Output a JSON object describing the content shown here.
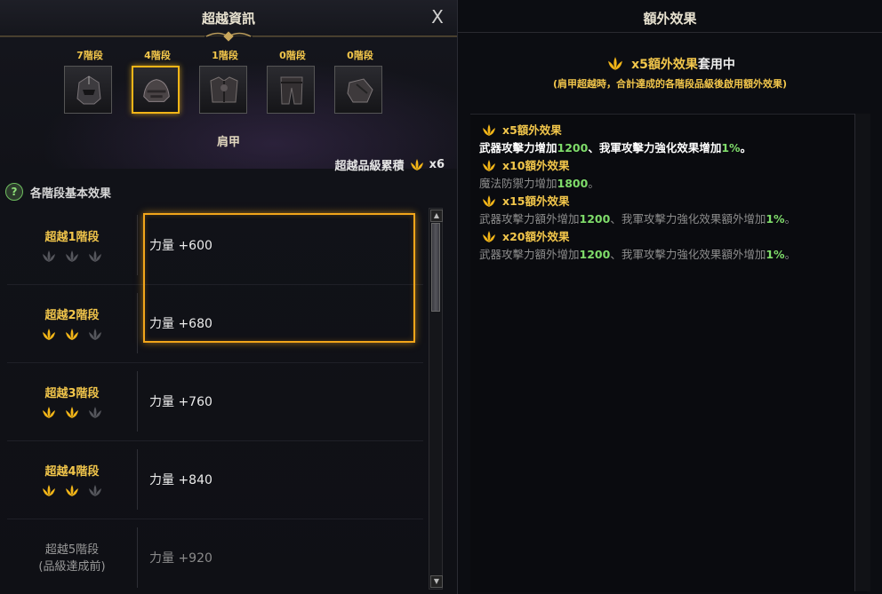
{
  "left_panel": {
    "title": "超越資訊",
    "close_label": "X",
    "gear": [
      {
        "stage": "7階段",
        "icon": "helmet-icon"
      },
      {
        "stage": "4階段",
        "icon": "shoulder-armor-icon"
      },
      {
        "stage": "1階段",
        "icon": "chest-armor-icon"
      },
      {
        "stage": "0階段",
        "icon": "pants-armor-icon"
      },
      {
        "stage": "0階段",
        "icon": "gloves-icon"
      }
    ],
    "selected_part": "肩甲",
    "cumulative_label": "超越品級累積",
    "cumulative_count": "x6",
    "basic_effects_title": "各階段基本效果",
    "rows": [
      {
        "stage": "超越1階段",
        "sub": "",
        "value": "力量 +600",
        "flowers_lit": 0,
        "locked": false
      },
      {
        "stage": "超越2階段",
        "sub": "",
        "value": "力量 +680",
        "flowers_lit": 2,
        "locked": false
      },
      {
        "stage": "超越3階段",
        "sub": "",
        "value": "力量 +760",
        "flowers_lit": 2,
        "locked": false
      },
      {
        "stage": "超越4階段",
        "sub": "",
        "value": "力量 +840",
        "flowers_lit": 2,
        "locked": false
      },
      {
        "stage": "超越5階段",
        "sub": "(品級達成前)",
        "value": "力量 +920",
        "flowers_lit": 0,
        "locked": true
      }
    ]
  },
  "right_panel": {
    "title": "額外效果",
    "active_gold": "x5額外效果",
    "active_white": "套用中",
    "note": "(肩甲超越時，合計達成的各階段品級後啟用額外效果)",
    "effects": [
      {
        "head": "x5額外效果",
        "pre": "武器攻擊力增加",
        "n1": "1200",
        "mid": "、我軍攻擊力強化效果增加",
        "n2": "1%",
        "post": "。",
        "active": true
      },
      {
        "head": "x10額外效果",
        "pre": "魔法防禦力增加",
        "n1": "1800",
        "mid": "",
        "n2": "",
        "post": "。",
        "active": false
      },
      {
        "head": "x15額外效果",
        "pre": "武器攻擊力額外增加",
        "n1": "1200",
        "mid": "、我軍攻擊力強化效果額外增加",
        "n2": "1%",
        "post": "。",
        "active": false
      },
      {
        "head": "x20額外效果",
        "pre": "武器攻擊力額外增加",
        "n1": "1200",
        "mid": "、我軍攻擊力強化效果額外增加",
        "n2": "1%",
        "post": "。",
        "active": false
      }
    ]
  },
  "colors": {
    "accent_gold": "#f2c64b",
    "highlight": "#f2a51a",
    "number_green": "#7fdc6a"
  }
}
